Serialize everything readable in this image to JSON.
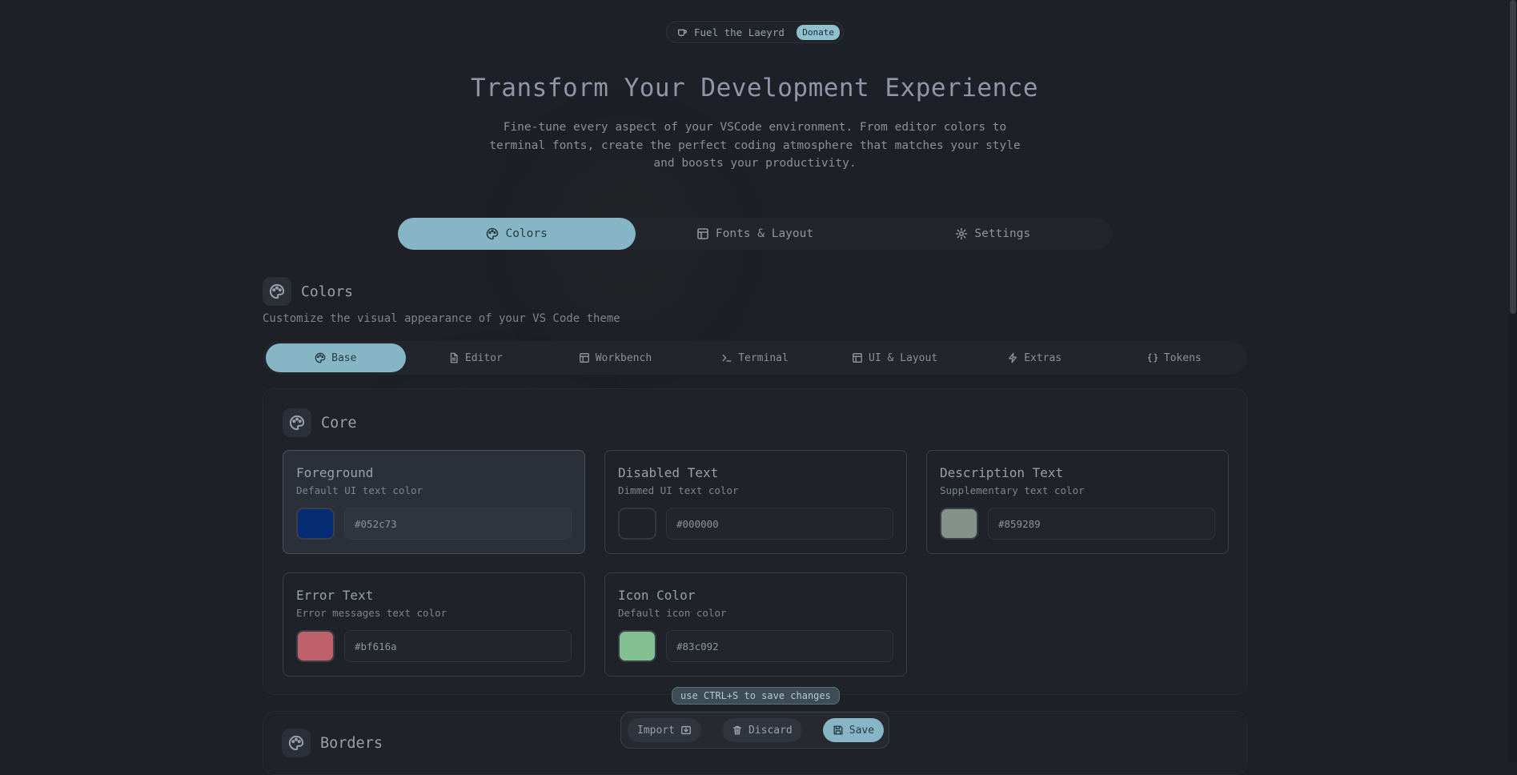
{
  "top_pill": {
    "label": "Fuel the Laeyrd",
    "donate": "Donate"
  },
  "hero": {
    "title": "Transform Your Development Experience",
    "description": "Fine-tune every aspect of your VSCode environment. From editor colors to terminal fonts, create the perfect coding atmosphere that matches your style and boosts your productivity."
  },
  "main_tabs": [
    {
      "label": "Colors",
      "icon": "palette-icon",
      "active": true
    },
    {
      "label": "Fonts & Layout",
      "icon": "layout-icon",
      "active": false
    },
    {
      "label": "Settings",
      "icon": "gear-icon",
      "active": false
    }
  ],
  "section": {
    "title": "Colors",
    "subtitle": "Customize the visual appearance of your VS Code theme"
  },
  "sub_tabs": [
    {
      "label": "Base",
      "icon": "palette-icon",
      "active": true
    },
    {
      "label": "Editor",
      "icon": "file-icon",
      "active": false
    },
    {
      "label": "Workbench",
      "icon": "layout-icon",
      "active": false
    },
    {
      "label": "Terminal",
      "icon": "terminal-icon",
      "active": false
    },
    {
      "label": "UI & Layout",
      "icon": "layout-icon",
      "active": false
    },
    {
      "label": "Extras",
      "icon": "zap-icon",
      "active": false
    },
    {
      "label": "Tokens",
      "icon": "braces-icon",
      "active": false
    }
  ],
  "core": {
    "title": "Core",
    "cards": [
      {
        "title": "Foreground",
        "desc": "Default UI text color",
        "value": "#052c73",
        "color": "#052c73"
      },
      {
        "title": "Disabled Text",
        "desc": "Dimmed UI text color",
        "value": "#000000",
        "color": "#1f2229"
      },
      {
        "title": "Description Text",
        "desc": "Supplementary text color",
        "value": "#859289",
        "color": "#859289"
      },
      {
        "title": "Error Text",
        "desc": "Error messages text color",
        "value": "#bf616a",
        "color": "#bf616a"
      },
      {
        "title": "Icon Color",
        "desc": "Default icon color",
        "value": "#83c092",
        "color": "#83c092"
      }
    ]
  },
  "borders": {
    "title": "Borders"
  },
  "hint": "use CTRL+S to save changes",
  "actions": {
    "import": "Import",
    "discard": "Discard",
    "save": "Save"
  },
  "colors": {
    "accent": "#86b6c5",
    "background": "#1d2027"
  }
}
